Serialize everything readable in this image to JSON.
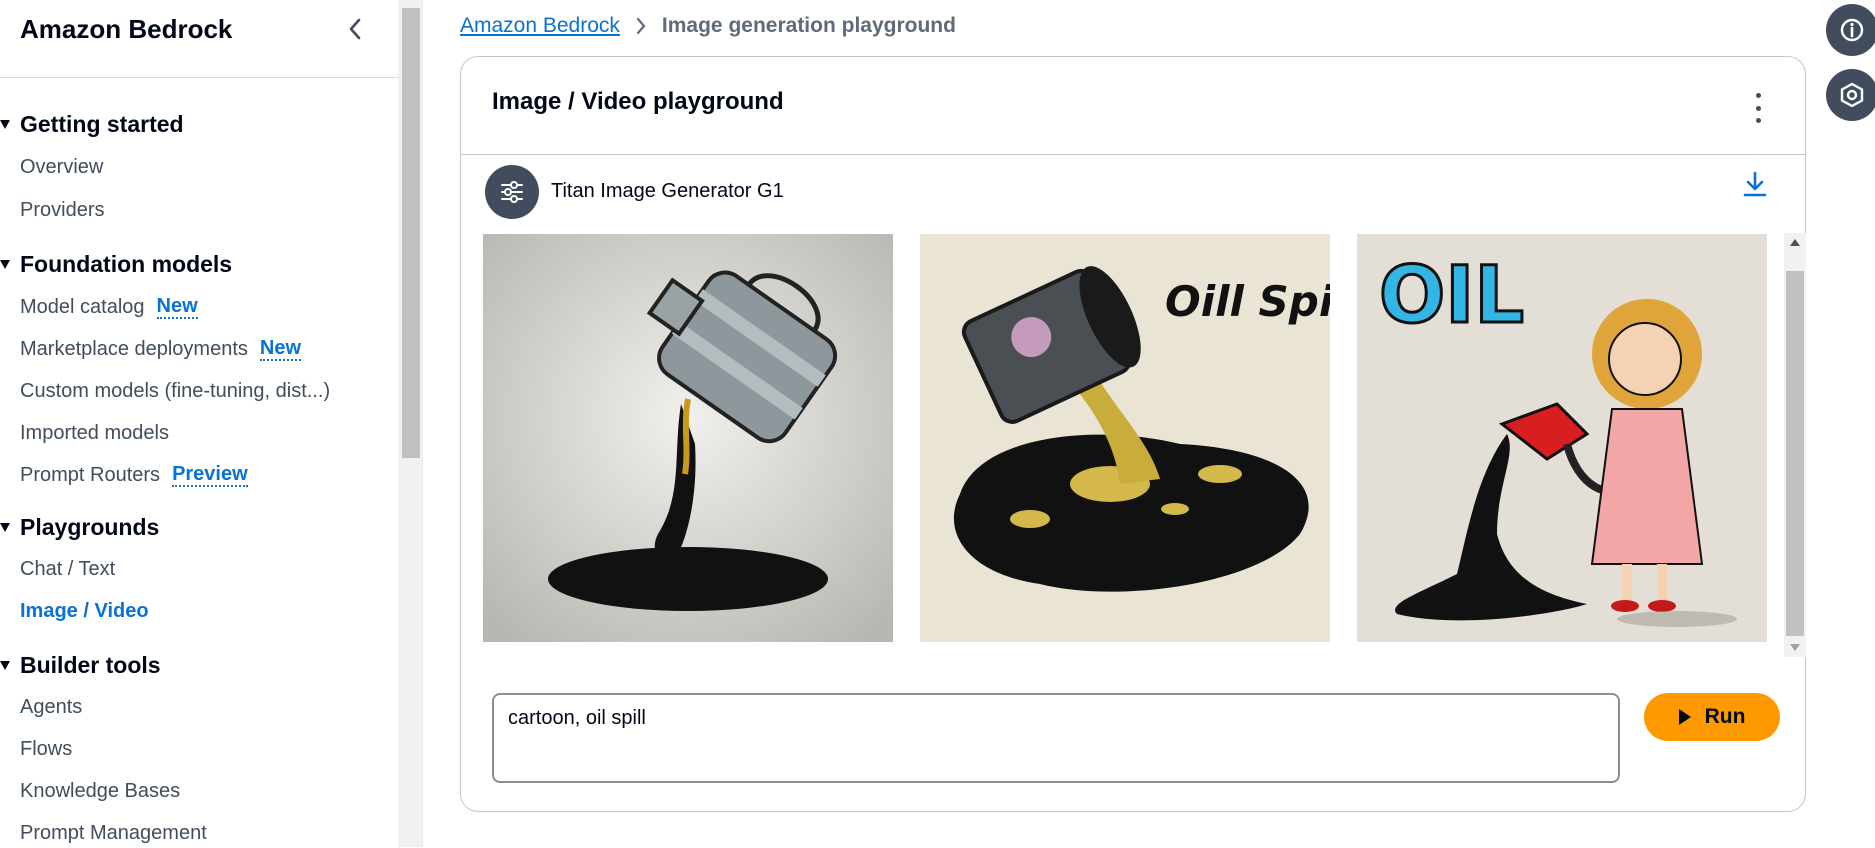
{
  "sidebar": {
    "title": "Amazon Bedrock",
    "sections": [
      {
        "label": "Getting started",
        "items": [
          {
            "label": "Overview"
          },
          {
            "label": "Providers"
          }
        ]
      },
      {
        "label": "Foundation models",
        "items": [
          {
            "label": "Model catalog",
            "badge": "New"
          },
          {
            "label": "Marketplace deployments",
            "badge": "New"
          },
          {
            "label": "Custom models (fine-tuning, dist...)"
          },
          {
            "label": "Imported models"
          },
          {
            "label": "Prompt Routers",
            "badge": "Preview"
          }
        ]
      },
      {
        "label": "Playgrounds",
        "items": [
          {
            "label": "Chat / Text"
          },
          {
            "label": "Image / Video",
            "active": true
          }
        ]
      },
      {
        "label": "Builder tools",
        "items": [
          {
            "label": "Agents"
          },
          {
            "label": "Flows"
          },
          {
            "label": "Knowledge Bases"
          },
          {
            "label": "Prompt Management"
          }
        ]
      }
    ]
  },
  "breadcrumb": {
    "root": "Amazon Bedrock",
    "current": "Image generation playground"
  },
  "panel": {
    "title": "Image / Video playground",
    "model_name": "Titan Image Generator G1",
    "images": [
      {
        "alt": "oil can pouring black oil",
        "text": ""
      },
      {
        "alt": "barrel spilling oil puddle",
        "text": "Oill Spill"
      },
      {
        "alt": "girl with red watering can pouring oil",
        "text": "OIL"
      }
    ],
    "prompt_value": "cartoon, oil spill",
    "run_label": "Run"
  },
  "icons": {
    "settings": "sliders-icon",
    "download": "download-icon",
    "info": "info-icon",
    "help": "hexagon-icon"
  },
  "colors": {
    "accent": "#0972d3",
    "run": "#ff9900",
    "text": "#000716"
  }
}
